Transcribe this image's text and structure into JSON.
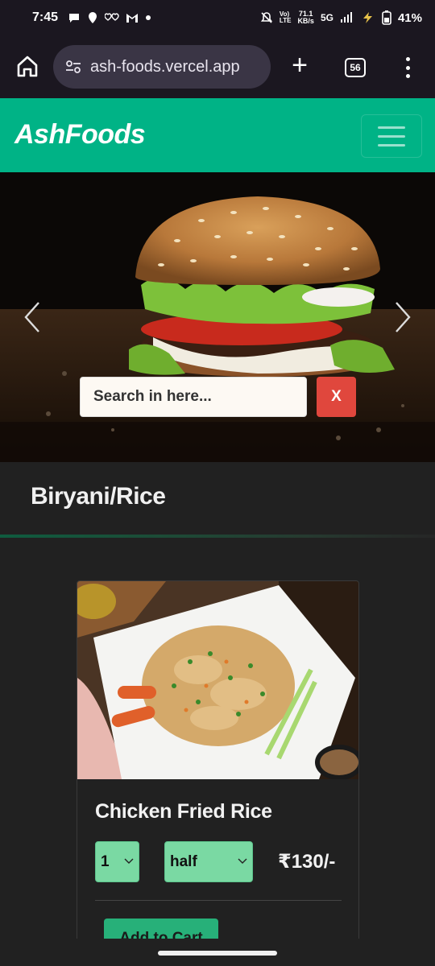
{
  "status_bar": {
    "time": "7:45",
    "network_speed": "71.1\nKB/s",
    "network_type": "5G",
    "battery": "41%",
    "volte_label": "Vo)\nLTE"
  },
  "browser": {
    "url": "ash-foods.vercel.app",
    "tab_count": "56"
  },
  "navbar": {
    "brand": "AshFoods"
  },
  "hero": {
    "search_placeholder": "Search in here...",
    "clear_label": "X"
  },
  "menu": {
    "category_title": "Biryani/Rice",
    "items": [
      {
        "name": "Chicken Fried Rice",
        "quantity": "1",
        "size": "half",
        "price": "₹130/-",
        "add_to_cart_label": "Add to Cart"
      }
    ]
  },
  "colors": {
    "brand_green": "#00b386",
    "select_green": "#7ad9a3",
    "danger_red": "#e0473d",
    "page_bg": "#212121"
  }
}
